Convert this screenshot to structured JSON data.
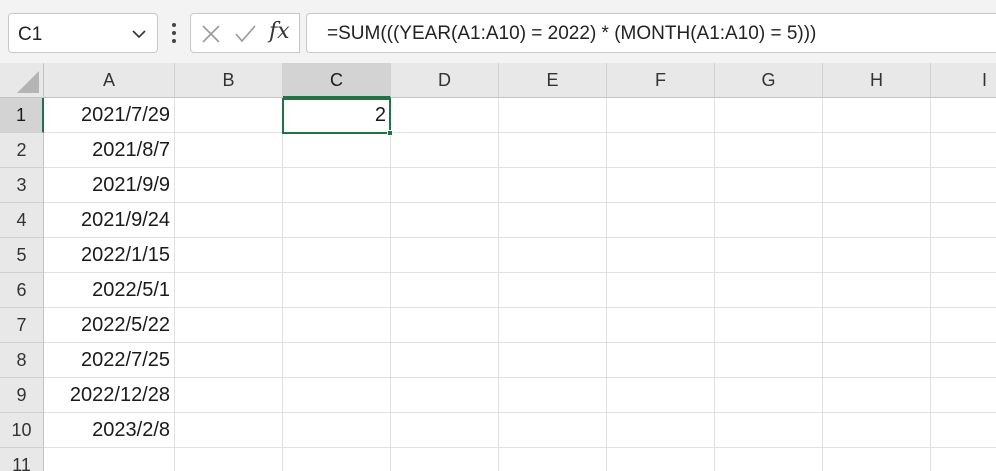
{
  "name_box": {
    "value": "C1",
    "icon": "chevron-down-icon"
  },
  "formula_bar": {
    "cancel_icon": "x-icon",
    "enter_icon": "checkmark-icon",
    "function_label": "fx",
    "formula": "=SUM(((YEAR(A1:A10) = 2022) * (MONTH(A1:A10) = 5)))"
  },
  "active_cell": "C1",
  "accent_color": "#217346",
  "columns": [
    "A",
    "B",
    "C",
    "D",
    "E",
    "F",
    "G",
    "H",
    "I"
  ],
  "rows": [
    "1",
    "2",
    "3",
    "4",
    "5",
    "6",
    "7",
    "8",
    "9",
    "10",
    "11"
  ],
  "cells": {
    "A1": "2021/7/29",
    "A2": "2021/8/7",
    "A3": "2021/9/9",
    "A4": "2021/9/24",
    "A5": "2022/1/15",
    "A6": "2022/5/1",
    "A7": "2022/5/22",
    "A8": "2022/7/25",
    "A9": "2022/12/28",
    "A10": "2023/2/8",
    "C1": "2"
  }
}
